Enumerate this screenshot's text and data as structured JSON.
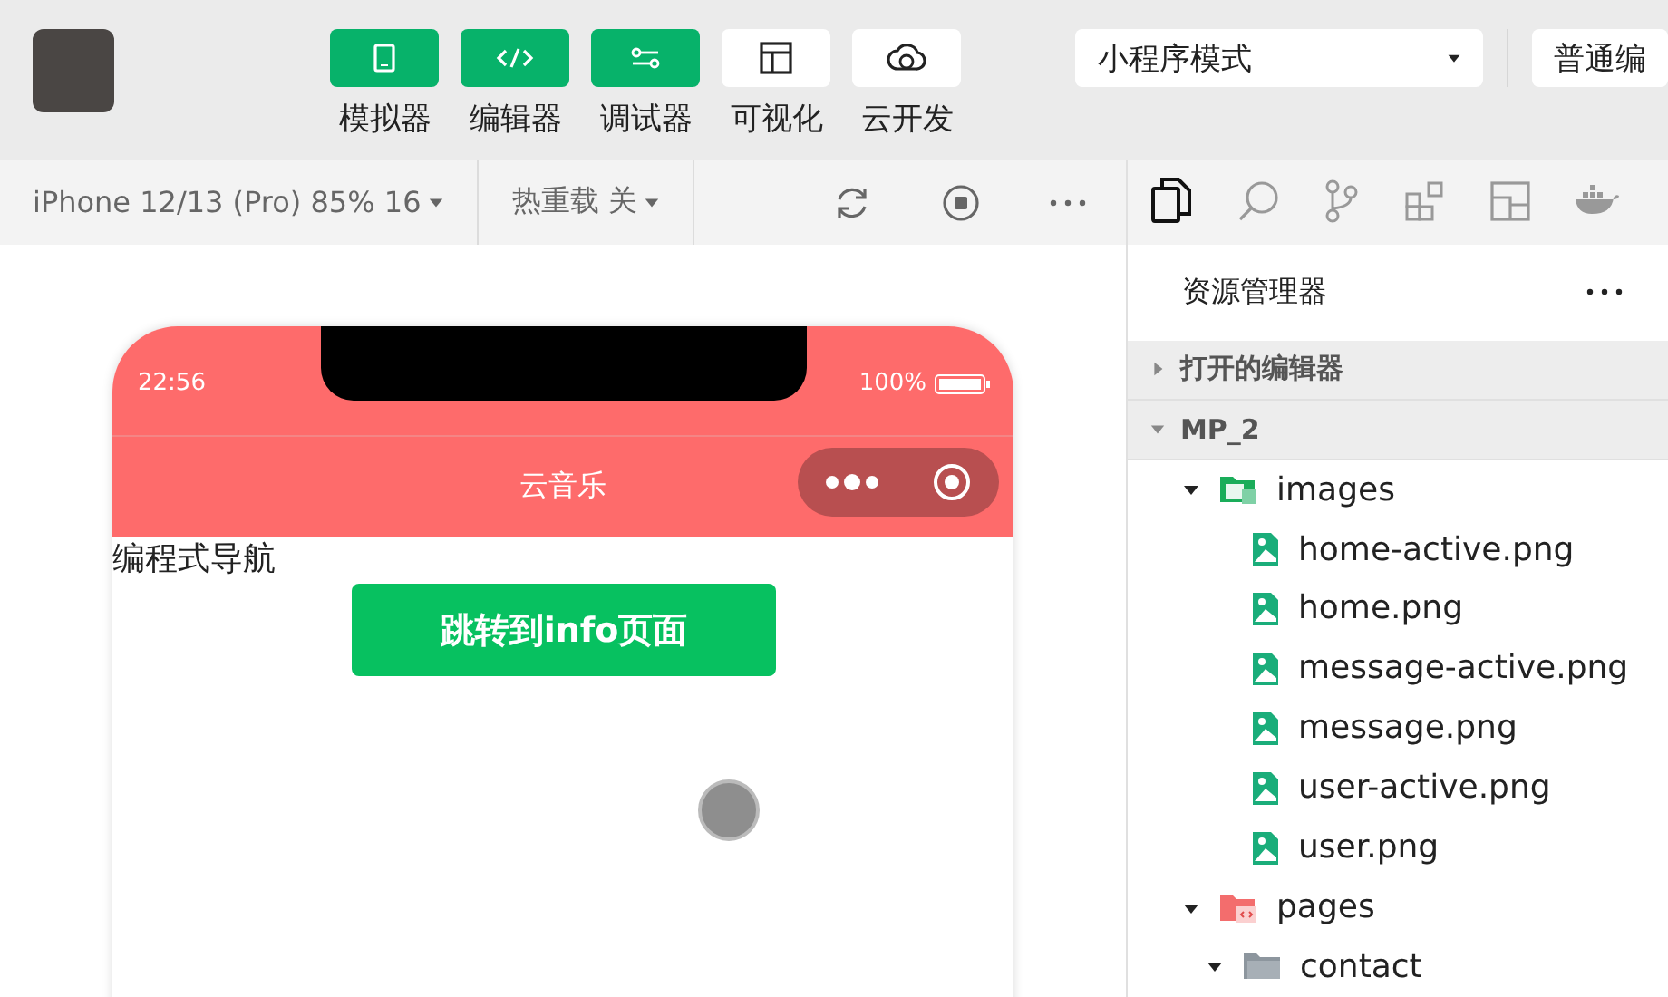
{
  "toolbar": {
    "buttons": [
      {
        "label": "模拟器",
        "kind": "phone",
        "on": true
      },
      {
        "label": "编辑器",
        "kind": "code",
        "on": true
      },
      {
        "label": "调试器",
        "kind": "debug",
        "on": true
      },
      {
        "label": "可视化",
        "kind": "layout",
        "on": false
      },
      {
        "label": "云开发",
        "kind": "cloud",
        "on": false
      }
    ],
    "mode_select": {
      "value": "小程序模式"
    },
    "compile_select": {
      "value": "普通编"
    }
  },
  "simulator_bar": {
    "device": "iPhone 12/13 (Pro) 85% 16",
    "hot_reload": "热重载 关"
  },
  "phone": {
    "time": "22:56",
    "battery": "100%",
    "nav_title": "云音乐",
    "content_text": "编程式导航",
    "button": "跳转到info页面"
  },
  "explorer": {
    "title": "资源管理器",
    "sections": [
      {
        "label": "打开的编辑器",
        "expanded": false
      },
      {
        "label": "MP_2",
        "expanded": true
      }
    ],
    "tree": [
      {
        "label": "images",
        "kind": "image-folder",
        "expanded": true,
        "children": [
          {
            "label": "home-active.png",
            "kind": "image"
          },
          {
            "label": "home.png",
            "kind": "image"
          },
          {
            "label": "message-active.png",
            "kind": "image"
          },
          {
            "label": "message.png",
            "kind": "image"
          },
          {
            "label": "user-active.png",
            "kind": "image"
          },
          {
            "label": "user.png",
            "kind": "image"
          }
        ]
      },
      {
        "label": "pages",
        "kind": "page-folder",
        "expanded": true,
        "children": [
          {
            "label": "contact",
            "kind": "folder",
            "expanded": true
          }
        ]
      }
    ]
  }
}
